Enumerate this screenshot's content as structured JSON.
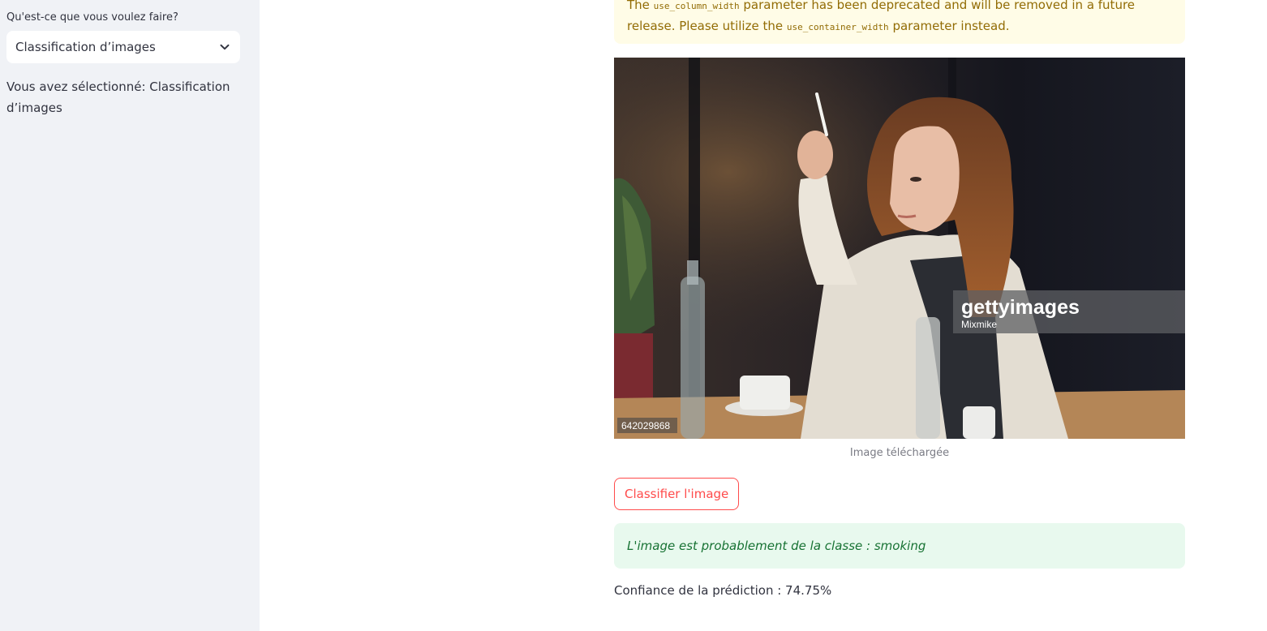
{
  "sidebar": {
    "select_label": "Qu'est-ce que vous voulez faire?",
    "select_value": "Classification d’images",
    "selected_text": "Vous avez sélectionné: Classification d’images"
  },
  "warning": {
    "part1": "The ",
    "code1": "use_column_width",
    "part2": " parameter has been deprecated and will be removed in a future release. Please utilize the ",
    "code2": "use_container_width",
    "part3": " parameter instead."
  },
  "image": {
    "watermark_brand": "gettyimages",
    "watermark_credit": "Mixmike",
    "watermark_id": "642029868",
    "caption": "Image téléchargée"
  },
  "classify_button": "Classifier l'image",
  "result_text": "L'image est probablement de la classe : smoking",
  "confidence_text": "Confiance de la prédiction : 74.75%",
  "colors": {
    "accent": "#ff4b4b",
    "sidebar_bg": "#f0f2f6",
    "warning_bg": "#fffce7",
    "warning_text": "#926c05",
    "success_bg": "#e8f9ee",
    "success_text": "#177233"
  }
}
